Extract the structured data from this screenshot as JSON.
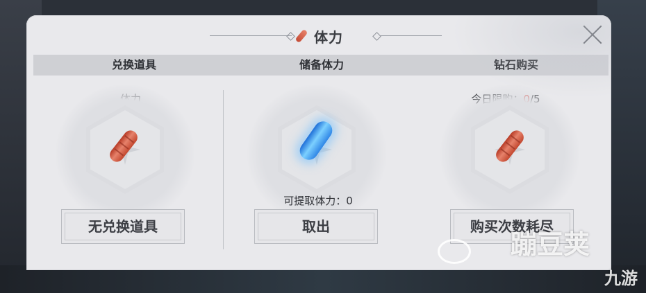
{
  "dialog": {
    "title": "体力",
    "title_icon": "sausage-icon",
    "close_icon": "close-icon"
  },
  "columns": {
    "exchange": {
      "header": "兑换道具",
      "label": "体力",
      "item_icon": "sausage-icon",
      "button": "无兑换道具"
    },
    "reserve": {
      "header": "储备体力",
      "item_icon": "blue-crystal-sausage-icon",
      "extractable_label": "可提取体力：0",
      "button": "取出"
    },
    "diamond": {
      "header": "钻石购买",
      "limit_label": "今日限购：",
      "limit_used": "0",
      "limit_total": "/5",
      "item_icon": "sausage-icon",
      "button": "购买次数耗尽"
    }
  },
  "watermark": {
    "text1": "蹦豆荚",
    "text2": "九游"
  },
  "colors": {
    "panel": "#e9e9ec",
    "header_bar": "#cfd0d4",
    "limit_highlight": "#d2413a"
  }
}
